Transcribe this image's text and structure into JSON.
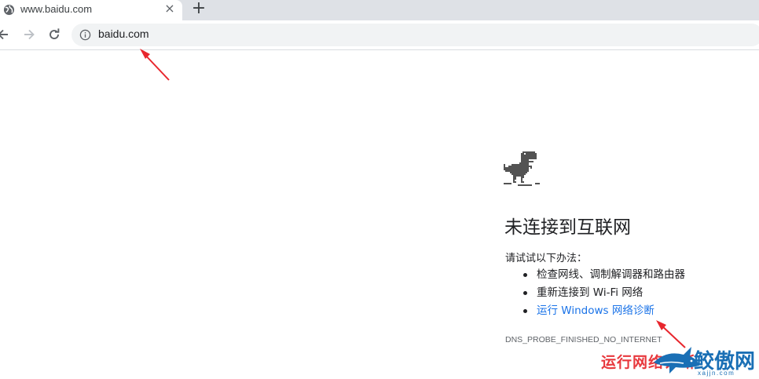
{
  "tab": {
    "title": "www.baidu.com",
    "close_glyph": "×",
    "favicon": "globe-icon"
  },
  "new_tab_glyph": "+",
  "toolbar": {
    "url": "baidu.com",
    "back_icon": "back-arrow-icon",
    "forward_icon": "forward-arrow-icon",
    "reload_icon": "reload-icon",
    "info_icon": "info-icon"
  },
  "error_page": {
    "heading": "未连接到互联网",
    "intro": "请试试以下办法：",
    "suggestions": [
      {
        "text": "检查网线、调制解调器和路由器",
        "link": false
      },
      {
        "text": "重新连接到 Wi-Fi 网络",
        "link": true
      },
      {
        "text": "运行 Windows 网络诊断",
        "link": true
      }
    ],
    "error_code": "DNS_PROBE_FINISHED_NO_INTERNET"
  },
  "annotations": {
    "arrow_color": "#e8262d"
  },
  "watermark": {
    "caption": "运行网络诊断",
    "brand": "鲛傲网",
    "sub": "xajjn.com"
  },
  "colors": {
    "tabstrip_bg": "#dee1e6",
    "omnibox_bg": "#f1f3f4",
    "link": "#1a73e8",
    "text": "#202124"
  }
}
